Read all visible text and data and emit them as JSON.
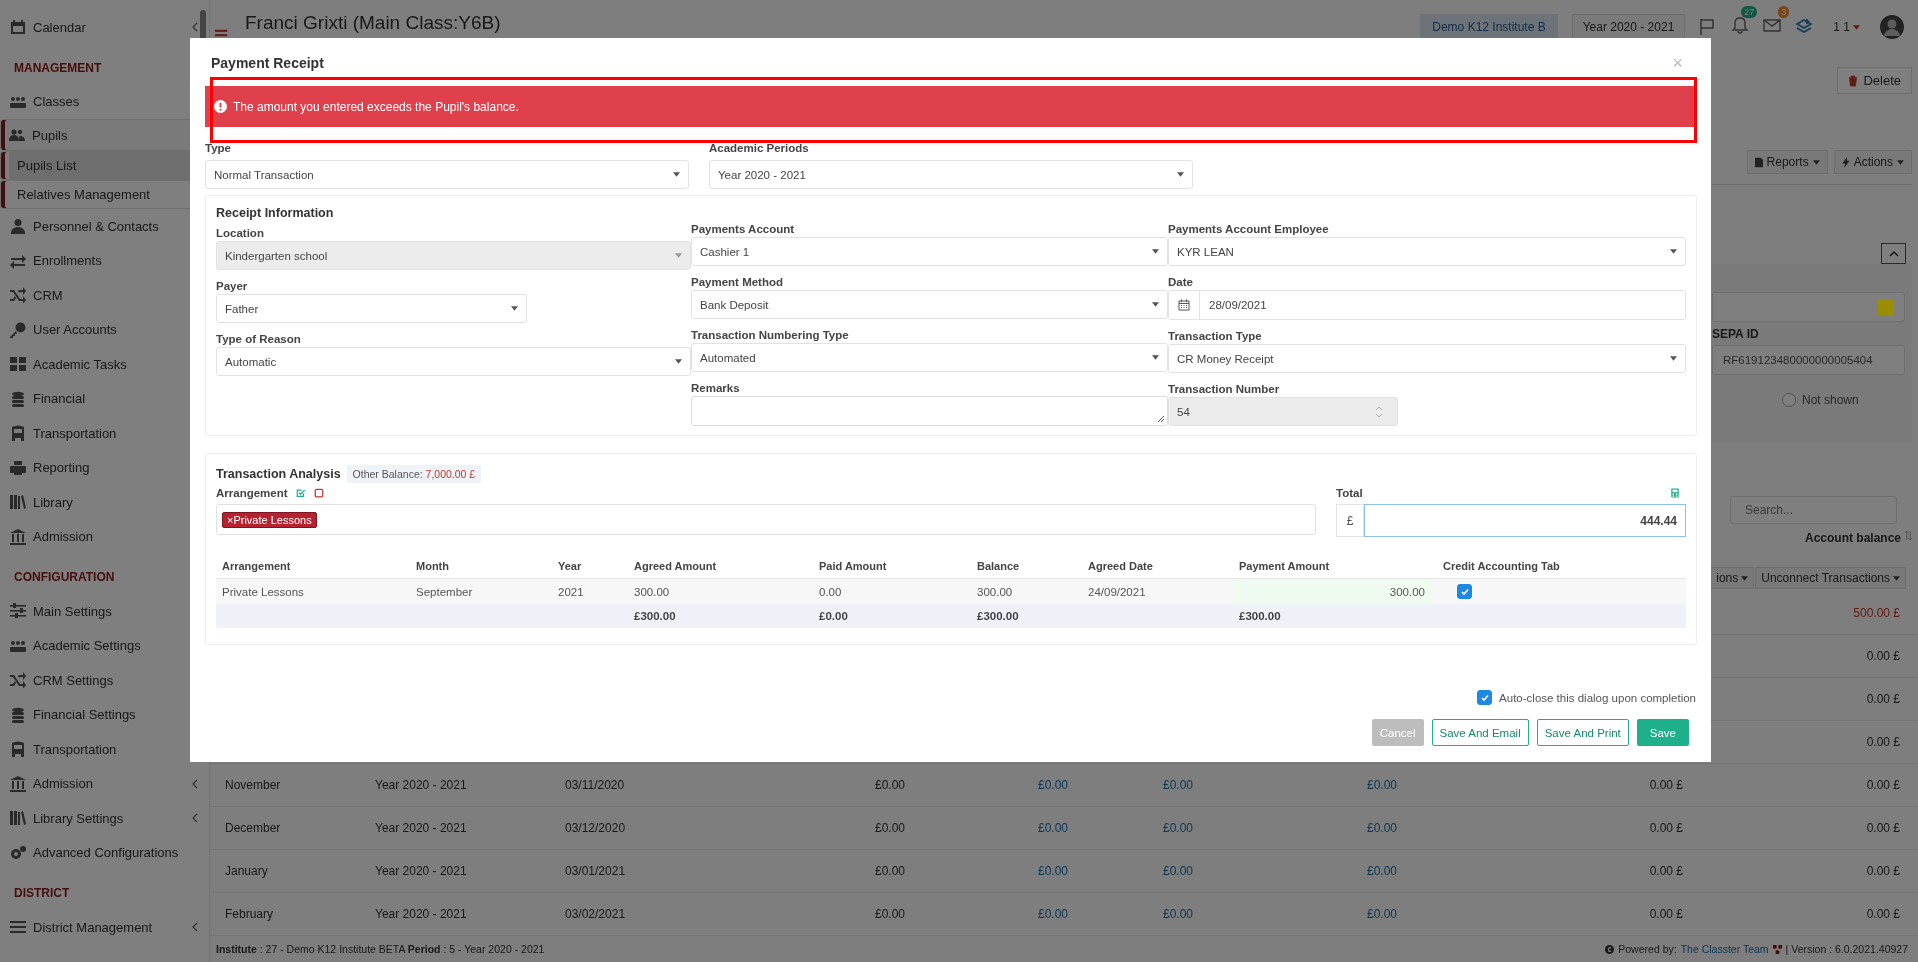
{
  "sidebar": {
    "items": [
      {
        "kind": "item",
        "label": "Calendar",
        "selected": false,
        "submenu": true
      },
      {
        "kind": "heading",
        "label": "MANAGEMENT"
      },
      {
        "kind": "item",
        "label": "Classes",
        "selected": false
      },
      {
        "kind": "item",
        "label": "Pupils",
        "selected": true,
        "children": [
          {
            "label": "Pupils List",
            "selected": true
          },
          {
            "label": "Relatives Management",
            "selected": false
          }
        ]
      },
      {
        "kind": "item",
        "label": "Personnel & Contacts",
        "selected": false
      },
      {
        "kind": "item",
        "label": "Enrollments",
        "selected": false
      },
      {
        "kind": "item",
        "label": "CRM",
        "selected": false
      },
      {
        "kind": "item",
        "label": "User Accounts",
        "selected": false
      },
      {
        "kind": "item",
        "label": "Academic Tasks",
        "selected": false
      },
      {
        "kind": "item",
        "label": "Financial",
        "selected": false
      },
      {
        "kind": "item",
        "label": "Transportation",
        "selected": false
      },
      {
        "kind": "item",
        "label": "Reporting",
        "selected": false
      },
      {
        "kind": "item",
        "label": "Library",
        "selected": false
      },
      {
        "kind": "item",
        "label": "Admission",
        "selected": false
      },
      {
        "kind": "heading",
        "label": "CONFIGURATION"
      },
      {
        "kind": "item",
        "label": "Main Settings",
        "selected": false
      },
      {
        "kind": "item",
        "label": "Academic Settings",
        "selected": false
      },
      {
        "kind": "item",
        "label": "CRM Settings",
        "selected": false
      },
      {
        "kind": "item",
        "label": "Financial Settings",
        "selected": false
      },
      {
        "kind": "item",
        "label": "Transportation",
        "selected": false
      },
      {
        "kind": "item",
        "label": "Admission",
        "selected": false,
        "submenu": true
      },
      {
        "kind": "item",
        "label": "Library Settings",
        "selected": false,
        "submenu": true
      },
      {
        "kind": "item",
        "label": "Advanced Configurations",
        "selected": false,
        "submenu": false
      },
      {
        "kind": "heading",
        "label": "DISTRICT"
      },
      {
        "kind": "item",
        "label": "District Management",
        "selected": false,
        "submenu": true
      }
    ]
  },
  "header": {
    "title": "Franci Grixti (Main Class:Y6B)",
    "institute": "Demo K12 Institute B",
    "year": "Year 2020 - 2021",
    "notifications": "27",
    "messages": "3",
    "user": "1 1"
  },
  "toolbar": {
    "delete": "Delete"
  },
  "panel": {
    "reports": "Reports",
    "actions": "Actions",
    "color_field": {
      "color": "#9a8e00"
    },
    "sepa_label": "SEPA ID",
    "sepa_value": "RF619123480000000005404",
    "not_shown": {
      "label": "Not shown",
      "checked": false
    },
    "search": {
      "placeholder": "Search..."
    },
    "balance_heading": "Account balance",
    "cut_button": "ions",
    "unconnect": "Unconnect Transactions",
    "balances": [
      {
        "value": "500.00 £",
        "overdue": true
      },
      {
        "value": "0.00 £",
        "overdue": false
      },
      {
        "value": "0.00 £",
        "overdue": false
      },
      {
        "value": "0.00 £",
        "overdue": false
      }
    ]
  },
  "table": {
    "columns": [
      {
        "kind": "text"
      },
      {
        "kind": "text"
      },
      {
        "kind": "text"
      },
      {
        "kind": "amount"
      },
      {
        "kind": "link"
      },
      {
        "kind": "link"
      },
      {
        "kind": "link"
      },
      {
        "kind": "amount"
      },
      {
        "kind": "amount"
      }
    ],
    "rows": [
      {
        "cells": [
          "November",
          "Year 2020 - 2021",
          "03/11/2020",
          "£0.00",
          "£0.00",
          "£0.00",
          "£0.00",
          "0.00 £",
          "0.00 £"
        ]
      },
      {
        "cells": [
          "December",
          "Year 2020 - 2021",
          "03/12/2020",
          "£0.00",
          "£0.00",
          "£0.00",
          "£0.00",
          "0.00 £",
          "0.00 £"
        ]
      },
      {
        "cells": [
          "January",
          "Year 2020 - 2021",
          "03/01/2021",
          "£0.00",
          "£0.00",
          "£0.00",
          "£0.00",
          "0.00 £",
          "0.00 £"
        ]
      },
      {
        "cells": [
          "February",
          "Year 2020 - 2021",
          "03/02/2021",
          "£0.00",
          "£0.00",
          "£0.00",
          "£0.00",
          "0.00 £",
          "0.00 £"
        ]
      }
    ]
  },
  "footer": {
    "info": "**Institute** : 27 - Demo K12 Institute BETA **Period** : 5 - Year 2020 - 2021",
    "powered": "Powered by:",
    "team": "The Classter Team",
    "version": "| Version : 6.0.2021.40927"
  },
  "modal": {
    "title": "Payment Receipt",
    "close": "×",
    "alert": "The amount you entered exceeds the Pupil's balance.",
    "top_fields": [
      {
        "label": "Type",
        "value": "Normal Transaction"
      },
      {
        "label": "Academic Periods",
        "value": "Year 2020 - 2021"
      }
    ],
    "receipt": {
      "heading": "Receipt Information",
      "columns": [
        [
          {
            "label": "Location",
            "value": "Kindergarten school",
            "kind": "select",
            "disabled": true
          },
          {
            "label": "Payer",
            "value": "Father",
            "kind": "select",
            "disabled": false
          },
          {
            "label": "Type of Reason",
            "value": "Automatic",
            "kind": "select",
            "disabled": false
          }
        ],
        [
          {
            "label": "Payments Account",
            "value": "Cashier 1",
            "kind": "select",
            "disabled": false
          },
          {
            "label": "Payment Method",
            "value": "Bank Deposit",
            "kind": "select",
            "disabled": false
          },
          {
            "label": "Transaction Numbering Type",
            "value": "Automated",
            "kind": "select",
            "disabled": false
          },
          {
            "label": "Remarks",
            "kind": "textarea",
            "disabled": false
          }
        ],
        [
          {
            "label": "Payments Account Employee",
            "value": "KYR LEAN",
            "kind": "select",
            "disabled": false
          },
          {
            "label": "Date",
            "value": "28/09/2021",
            "kind": "date",
            "disabled": false
          },
          {
            "label": "Transaction Type",
            "value": "CR Money Receipt",
            "kind": "select",
            "disabled": false
          },
          {
            "label": "Transaction Number",
            "value": "54",
            "kind": "number",
            "disabled": true
          }
        ]
      ]
    },
    "analysis": {
      "heading": "Transaction Analysis",
      "balance_label": "Other Balance:",
      "balance_value": "7,000.00 £",
      "arrangement_label": "Arrangement",
      "tags": [
        {
          "remove": "×",
          "label": "Private Lessons"
        }
      ],
      "total_label": "Total",
      "currency": "£",
      "total": "444.44",
      "columns": [
        "Arrangement",
        "Month",
        "Year",
        "Agreed Amount",
        "Paid Amount",
        "Balance",
        "Agreed Date",
        "Payment Amount",
        "Credit Accounting Tab"
      ],
      "rows": [
        {
          "cells": [
            "Private Lessons",
            "September",
            "2021",
            "300.00",
            "0.00",
            "300.00",
            "24/09/2021"
          ],
          "payment": "300.00",
          "credit": true
        }
      ],
      "totals": {
        "agreed": "£300.00",
        "paid": "£0.00",
        "balance": "£300.00",
        "payment": "£300.00"
      }
    },
    "auto_close": {
      "label": "Auto-close this dialog upon completion",
      "checked": true
    },
    "buttons": [
      {
        "label": "Cancel",
        "kind": "muted"
      },
      {
        "label": "Save And Email",
        "kind": "outline"
      },
      {
        "label": "Save And Print",
        "kind": "outline"
      },
      {
        "label": "Save",
        "kind": "primary"
      }
    ]
  }
}
